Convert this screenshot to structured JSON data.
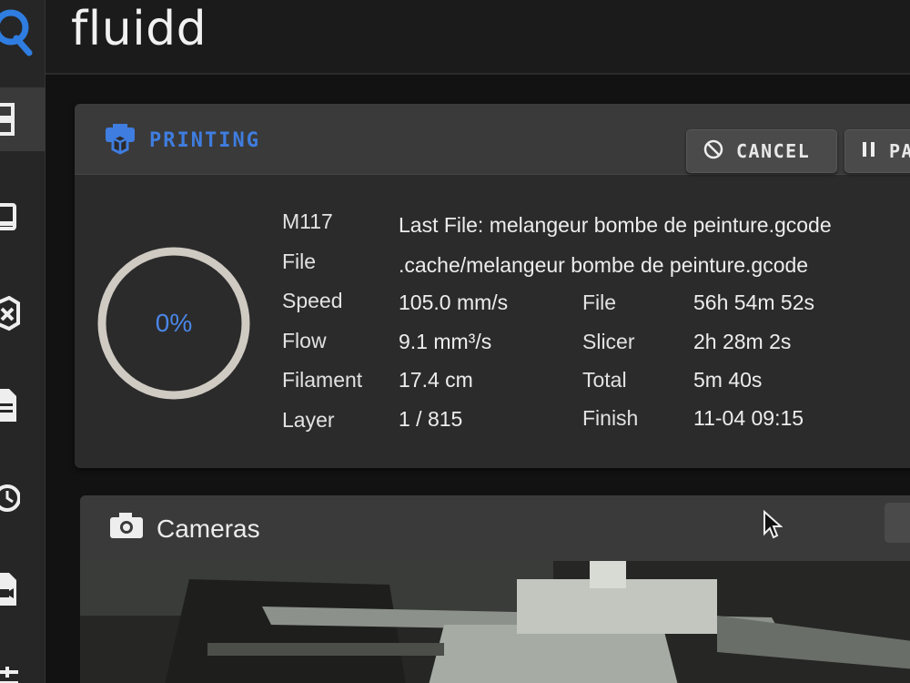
{
  "app": {
    "title": "fluidd"
  },
  "sidebar": {
    "items": [
      {
        "icon": "dashboard-icon",
        "active": true
      },
      {
        "icon": "console-icon",
        "active": false
      },
      {
        "icon": "printer-icon",
        "active": false
      },
      {
        "icon": "file-icon",
        "active": false
      },
      {
        "icon": "history-icon",
        "active": false
      },
      {
        "icon": "camera-file-icon",
        "active": false
      },
      {
        "icon": "tune-icon",
        "active": false
      }
    ]
  },
  "print_card": {
    "status": "PRINTING",
    "cancel_label": "CANCEL",
    "pause_label": "PA",
    "progress": {
      "percent_text": "0%",
      "fraction": 0.0
    },
    "details": [
      {
        "label": "M117",
        "value": "Last File: melangeur bombe de peinture.gcode"
      },
      {
        "label": "File",
        "value": ".cache/melangeur bombe de peinture.gcode"
      },
      {
        "label": "Speed",
        "value": "105.0 mm/s"
      },
      {
        "label": "Flow",
        "value": "9.1 mm³/s"
      },
      {
        "label": "Filament",
        "value": "17.4 cm"
      },
      {
        "label": "Layer",
        "value": "1 / 815"
      }
    ],
    "times": [
      {
        "label": "File",
        "value": "56h 54m 52s"
      },
      {
        "label": "Slicer",
        "value": "2h 28m 2s"
      },
      {
        "label": "Total",
        "value": "5m 40s"
      },
      {
        "label": "Finish",
        "value": "11-04 09:15"
      }
    ]
  },
  "cameras_card": {
    "title": "Cameras"
  },
  "colors": {
    "accent": "#3f7de0",
    "background": "#121212",
    "card": "#2b2b2b",
    "header": "#3a3a3a"
  }
}
